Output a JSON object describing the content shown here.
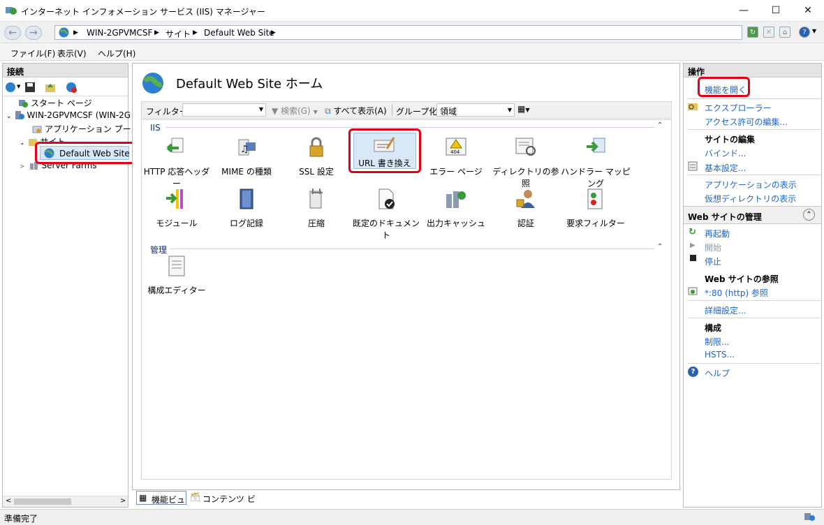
{
  "window": {
    "title": "インターネット インフォメーション サービス (IIS) マネージャー"
  },
  "address": {
    "crumbs": [
      "WIN-2GPVMCSF",
      "サイト",
      "Default Web Site"
    ]
  },
  "menu": [
    "ファイル(F)",
    "表示(V)",
    "ヘルプ(H)"
  ],
  "connections": {
    "title": "接続",
    "tree": {
      "start": "スタート ページ",
      "server": "WIN-2GPVMCSF (WIN-2G",
      "apppool": "アプリケーション プール",
      "sites": "サイト",
      "site": "Default Web Site",
      "farms": "Server Farms"
    }
  },
  "main": {
    "title": "Default Web Site ホーム",
    "filter_label": "フィルター:",
    "search": "検索(G)",
    "showall": "すべて表示(A)",
    "groupby_label": "グループ化:",
    "groupby_value": "領域",
    "sections": {
      "iis": "IIS",
      "manage": "管理"
    },
    "features": {
      "http": "HTTP 応答ヘッダー",
      "mime": "MIME の種類",
      "ssl": "SSL 設定",
      "url": "URL 書き換え",
      "error": "エラー ページ",
      "dir": "ディレクトリの参照",
      "handler": "ハンドラー マッピング",
      "module": "モジュール",
      "log": "ログ記録",
      "compress": "圧縮",
      "defdoc": "既定のドキュメント",
      "outcache": "出力キャッシュ",
      "auth": "認証",
      "reqfilter": "要求フィルター",
      "config": "構成エディター"
    },
    "views": {
      "feature": "機能ビュー",
      "content": "コンテンツ ビュー"
    }
  },
  "actions": {
    "title": "操作",
    "open": "機能を開く",
    "explorer": "エクスプローラー",
    "perm": "アクセス許可の編集...",
    "edit_site": "サイトの編集",
    "bind": "バインド...",
    "basic": "基本設定...",
    "viewapps": "アプリケーションの表示",
    "viewvdirs": "仮想ディレクトリの表示",
    "manage_site": "Web サイトの管理",
    "restart": "再起動",
    "start": "開始",
    "stop": "停止",
    "browse": "Web サイトの参照",
    "browse_link": "*:80 (http) 参照",
    "advanced": "詳細設定...",
    "config": "構成",
    "limits": "制限...",
    "hsts": "HSTS...",
    "help": "ヘルプ"
  },
  "status": {
    "text": "準備完了"
  },
  "colors": {
    "link": "#1e64c8",
    "highlight": "#e5001a"
  }
}
